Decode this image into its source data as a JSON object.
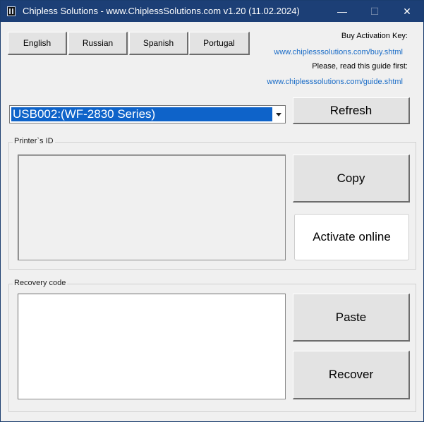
{
  "window": {
    "title": "Chipless Solutions - www.ChiplessSolutions.com v1.20 (11.02.2024)",
    "controls": {
      "minimize": "—",
      "maximize": "☐",
      "close": "✕"
    }
  },
  "languages": [
    {
      "label": "English"
    },
    {
      "label": "Russian"
    },
    {
      "label": "Spanish"
    },
    {
      "label": "Portugal"
    }
  ],
  "info": {
    "buy_label": "Buy Activation Key:",
    "buy_link": "www.chiplesssolutions.com/buy.shtml",
    "guide_label": "Please, read this guide first:",
    "guide_link": "www.chiplesssolutions.com/guide.shtml"
  },
  "printer_select": {
    "value": "USB002:(WF-2830 Series)"
  },
  "buttons": {
    "refresh": "Refresh",
    "copy": "Copy",
    "activate_online": "Activate online",
    "paste": "Paste",
    "recover": "Recover"
  },
  "groups": {
    "printer_id": {
      "label": "Printer`s ID",
      "value": ""
    },
    "recovery_code": {
      "label": "Recovery code",
      "value": ""
    }
  }
}
